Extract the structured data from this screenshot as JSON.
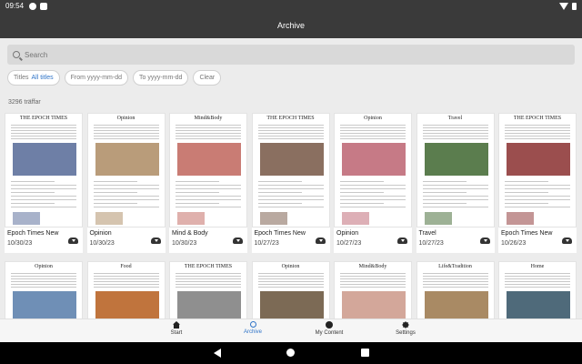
{
  "status_bar": {
    "time": "09:54"
  },
  "app_bar": {
    "title": "Archive"
  },
  "search": {
    "placeholder": "Search"
  },
  "filters": {
    "titles_label": "Titles",
    "titles_value": "All titles",
    "from_placeholder": "From yyyy-mm-dd",
    "to_placeholder": "To yyyy-mm-dd",
    "clear_label": "Clear"
  },
  "results": {
    "count_text": "3296 träffar"
  },
  "issues": [
    {
      "title": "Epoch Times New",
      "date": "10/30/23",
      "masthead": "THE EPOCH TIMES",
      "accent": "#6e7fa6"
    },
    {
      "title": "Opinion",
      "date": "10/30/23",
      "masthead": "Opinion",
      "accent": "#b99c7a"
    },
    {
      "title": "Mind & Body",
      "date": "10/30/23",
      "masthead": "Mind&Body",
      "accent": "#c97c74"
    },
    {
      "title": "Epoch Times New",
      "date": "10/27/23",
      "masthead": "THE EPOCH TIMES",
      "accent": "#8a6f60"
    },
    {
      "title": "Opinion",
      "date": "10/27/23",
      "masthead": "Opinion",
      "accent": "#c67a86"
    },
    {
      "title": "Travel",
      "date": "10/27/23",
      "masthead": "Travel",
      "accent": "#5b7d4e"
    },
    {
      "title": "Epoch Times New",
      "date": "10/26/23",
      "masthead": "THE EPOCH TIMES",
      "accent": "#9b4e4e"
    },
    {
      "title": "",
      "date": "",
      "masthead": "Opinion",
      "accent": "#6f8fb6"
    },
    {
      "title": "",
      "date": "",
      "masthead": "Food",
      "accent": "#c0743d"
    },
    {
      "title": "",
      "date": "",
      "masthead": "THE EPOCH TIMES",
      "accent": "#8f8f8f"
    },
    {
      "title": "",
      "date": "",
      "masthead": "Opinion",
      "accent": "#7c6a55"
    },
    {
      "title": "",
      "date": "",
      "masthead": "Mind&Body",
      "accent": "#d3a79a"
    },
    {
      "title": "",
      "date": "",
      "masthead": "Life&Tradition",
      "accent": "#a98a64"
    },
    {
      "title": "",
      "date": "",
      "masthead": "Home",
      "accent": "#4f6a7a"
    }
  ],
  "bottom_nav": [
    {
      "label": "Start",
      "icon": "home-icon",
      "active": false
    },
    {
      "label": "Archive",
      "icon": "search-icon",
      "active": true
    },
    {
      "label": "My Content",
      "icon": "person-icon",
      "active": false
    },
    {
      "label": "Settings",
      "icon": "gear-icon",
      "active": false
    }
  ],
  "colors": {
    "accent": "#2f74c8",
    "app_bar": "#3a3a3a"
  }
}
